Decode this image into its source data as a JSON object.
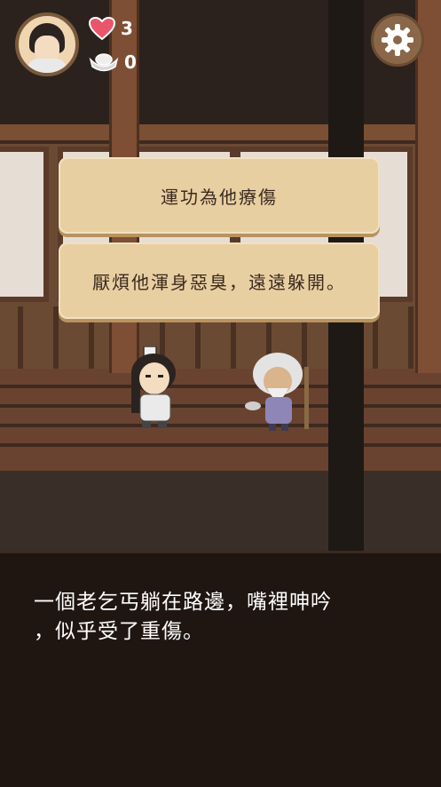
{
  "hud": {
    "avatar_icon": "hero-portrait",
    "hearts": "3",
    "silver": "0",
    "settings_icon": "gear-icon"
  },
  "choices": [
    {
      "label": "運功為他療傷"
    },
    {
      "label": "厭煩他渾身惡臭，遠遠躲開。"
    }
  ],
  "dialog": {
    "line1": "一個老乞丐躺在路邊，嘴裡呻吟",
    "line2": "，似乎受了重傷。"
  },
  "colors": {
    "choice_bg": "#e8cfa2",
    "choice_text": "#3b2a1e",
    "dialog_bg": "#1f1611",
    "heart": "#e8566b"
  }
}
